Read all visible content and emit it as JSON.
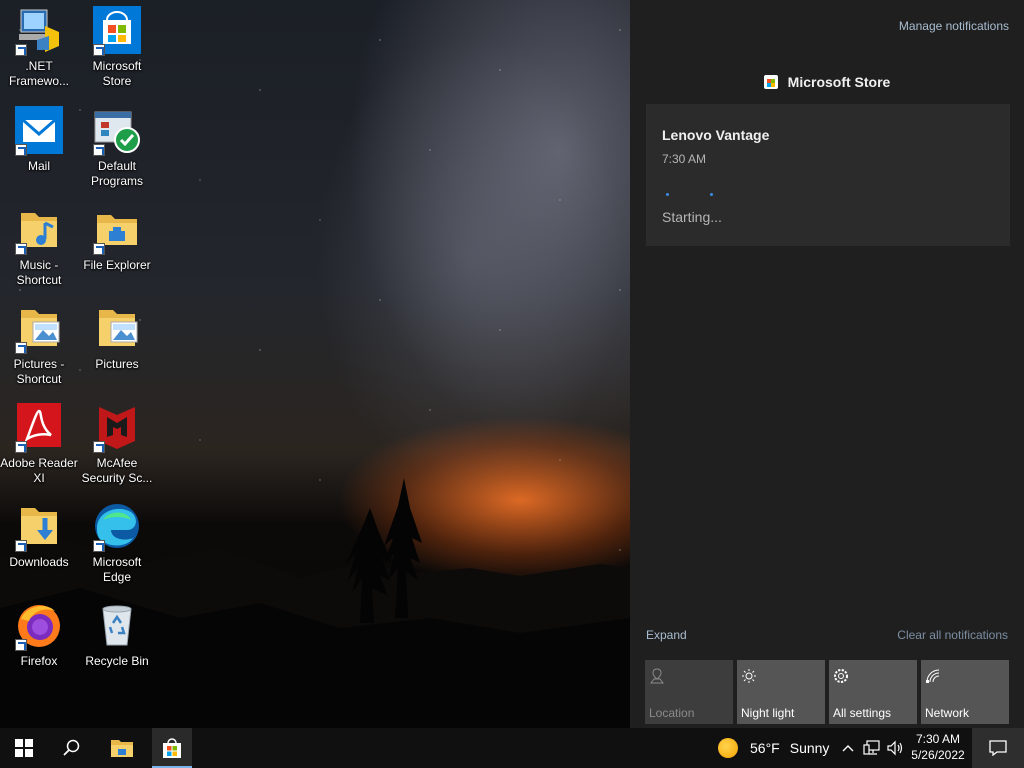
{
  "desktop": {
    "icons": [
      {
        "label": ".NET Framewo...",
        "icon": "dotnet-setup-icon"
      },
      {
        "label": "Microsoft Store",
        "icon": "microsoft-store-icon"
      },
      {
        "label": "Mail",
        "icon": "mail-icon"
      },
      {
        "label": "Default Programs",
        "icon": "default-programs-icon"
      },
      {
        "label": "Music - Shortcut",
        "icon": "music-folder-icon"
      },
      {
        "label": "File Explorer",
        "icon": "file-explorer-icon"
      },
      {
        "label": "Pictures - Shortcut",
        "icon": "pictures-folder-icon"
      },
      {
        "label": "Pictures",
        "icon": "pictures-folder-icon"
      },
      {
        "label": "Adobe Reader XI",
        "icon": "adobe-reader-icon"
      },
      {
        "label": "McAfee Security Sc...",
        "icon": "mcafee-icon"
      },
      {
        "label": "Downloads",
        "icon": "downloads-folder-icon"
      },
      {
        "label": "Microsoft Edge",
        "icon": "edge-icon"
      },
      {
        "label": "Firefox",
        "icon": "firefox-icon"
      },
      {
        "label": "Recycle Bin",
        "icon": "recycle-bin-icon"
      }
    ]
  },
  "action_center": {
    "manage_label": "Manage notifications",
    "group_title": "Microsoft Store",
    "toast": {
      "title": "Lenovo Vantage",
      "time": "7:30 AM",
      "status": "Starting..."
    },
    "expand_label": "Expand",
    "clear_label": "Clear all notifications",
    "quick_actions": [
      {
        "label": "Location",
        "icon": "location-icon",
        "enabled": false
      },
      {
        "label": "Night light",
        "icon": "night-light-icon",
        "enabled": true
      },
      {
        "label": "All settings",
        "icon": "gear-icon",
        "enabled": true
      },
      {
        "label": "Network",
        "icon": "network-icon",
        "enabled": true
      }
    ]
  },
  "taskbar": {
    "weather": {
      "temp": "56°F",
      "condition": "Sunny"
    },
    "clock": {
      "time": "7:30 AM",
      "date": "5/26/2022"
    }
  },
  "colors": {
    "accent": "#7ab4ea",
    "panel": "#1f1f1f",
    "toast": "#2b2b2b",
    "tile": "#555555",
    "link": "#a9bdd1"
  }
}
